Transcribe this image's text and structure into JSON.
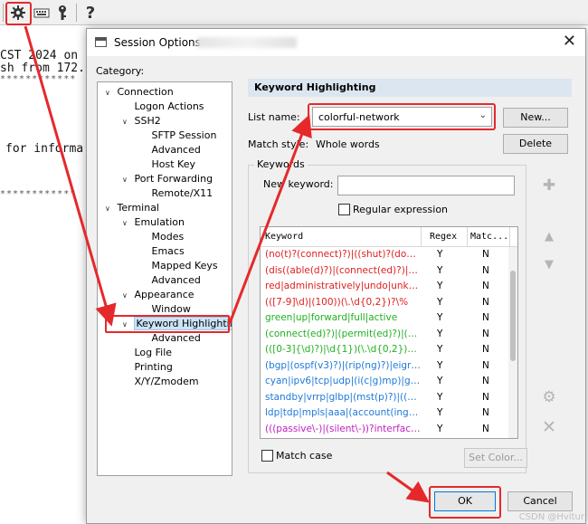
{
  "dialog": {
    "title": "Session Options -",
    "category_label": "Category:",
    "close_symbol": "✕"
  },
  "tree": [
    {
      "label": "Connection",
      "expanded": true
    },
    {
      "label": "Logon Actions"
    },
    {
      "label": "SSH2",
      "expanded": true
    },
    {
      "label": "SFTP Session"
    },
    {
      "label": "Advanced"
    },
    {
      "label": "Host Key"
    },
    {
      "label": "Port Forwarding",
      "expanded": true
    },
    {
      "label": "Remote/X11"
    },
    {
      "label": "Terminal",
      "expanded": true
    },
    {
      "label": "Emulation",
      "expanded": true
    },
    {
      "label": "Modes"
    },
    {
      "label": "Emacs"
    },
    {
      "label": "Mapped Keys"
    },
    {
      "label": "Advanced"
    },
    {
      "label": "Appearance",
      "expanded": true
    },
    {
      "label": "Window"
    },
    {
      "label": "Keyword Highlighting",
      "expanded": true,
      "selected": true
    },
    {
      "label": "Advanced"
    },
    {
      "label": "Log File"
    },
    {
      "label": "Printing"
    },
    {
      "label": "X/Y/Zmodem"
    }
  ],
  "panel": {
    "header": "Keyword Highlighting",
    "list_name_label": "List name:",
    "list_name_value": "colorful-network",
    "new_button": "New...",
    "match_style_label": "Match style:",
    "match_style_value": "Whole words",
    "delete_button": "Delete",
    "keywords_legend": "Keywords",
    "new_keyword_label": "New keyword:",
    "new_keyword_value": "",
    "regex_label": "Regular expression",
    "regex_checked": false,
    "match_case_label": "Match case",
    "match_case_checked": false,
    "set_color_button": "Set Color..."
  },
  "table": {
    "headers": [
      "Keyword",
      "Regex",
      "Matc..."
    ],
    "rows": [
      {
        "keyword": "(no(t)?(connect)?)|((shut)?(dow...",
        "regex": "Y",
        "match": "N",
        "color": "#e02020"
      },
      {
        "keyword": "(dis((able(d)?)|(connect(ed)?)|(a...",
        "regex": "Y",
        "match": "N",
        "color": "#e02020"
      },
      {
        "keyword": "red|administratively|undo|unkno...",
        "regex": "Y",
        "match": "N",
        "color": "#e02020"
      },
      {
        "keyword": "(([7-9]\\d)|(100))(\\.\\d{0,2})?\\%",
        "regex": "Y",
        "match": "N",
        "color": "#e02020"
      },
      {
        "keyword": "green|up|forward|full|active",
        "regex": "Y",
        "match": "N",
        "color": "#22b022"
      },
      {
        "keyword": "(connect(ed)?)|(permit(ed)?)|(es...",
        "regex": "Y",
        "match": "N",
        "color": "#22b022"
      },
      {
        "keyword": "(([0-3]{\\d)?)|\\d{1})(\\.\\d{0,2})?\\%",
        "regex": "Y",
        "match": "N",
        "color": "#22b022"
      },
      {
        "keyword": "(bgp|(ospf(v3)?)|(rip(ng)?)|eigrp...",
        "regex": "Y",
        "match": "N",
        "color": "#1e78d8"
      },
      {
        "keyword": "cyan|ipv6|tcp|udp|(i(c|g)mp)|gr...",
        "regex": "Y",
        "match": "N",
        "color": "#1e78d8"
      },
      {
        "keyword": "standby|vrrp|glbp|(mst(p)?)|((r)...",
        "regex": "Y",
        "match": "N",
        "color": "#1e78d8"
      },
      {
        "keyword": "ldp|tdp|mpls|aaa|(account(ing)?)...",
        "regex": "Y",
        "match": "N",
        "color": "#1e78d8"
      },
      {
        "keyword": "(((passive\\-)|(silent\\-))?interface...",
        "regex": "Y",
        "match": "N",
        "color": "#c020c0"
      }
    ]
  },
  "buttons": {
    "ok": "OK",
    "cancel": "Cancel"
  },
  "terminal": {
    "line1": "CST 2024 on",
    "line2": "sh from 172.",
    "line3": "for informa",
    "stars": "************"
  },
  "toolbar_icons": [
    "gear-icon",
    "keyboard-icon",
    "key-icon",
    "help-icon"
  ],
  "help_glyph": "?",
  "watermark": "CSDN @Hvitur",
  "colors": {
    "highlight_red": "#e5292b",
    "section_header": "#dce6f0",
    "selection": "#cce4f7"
  }
}
